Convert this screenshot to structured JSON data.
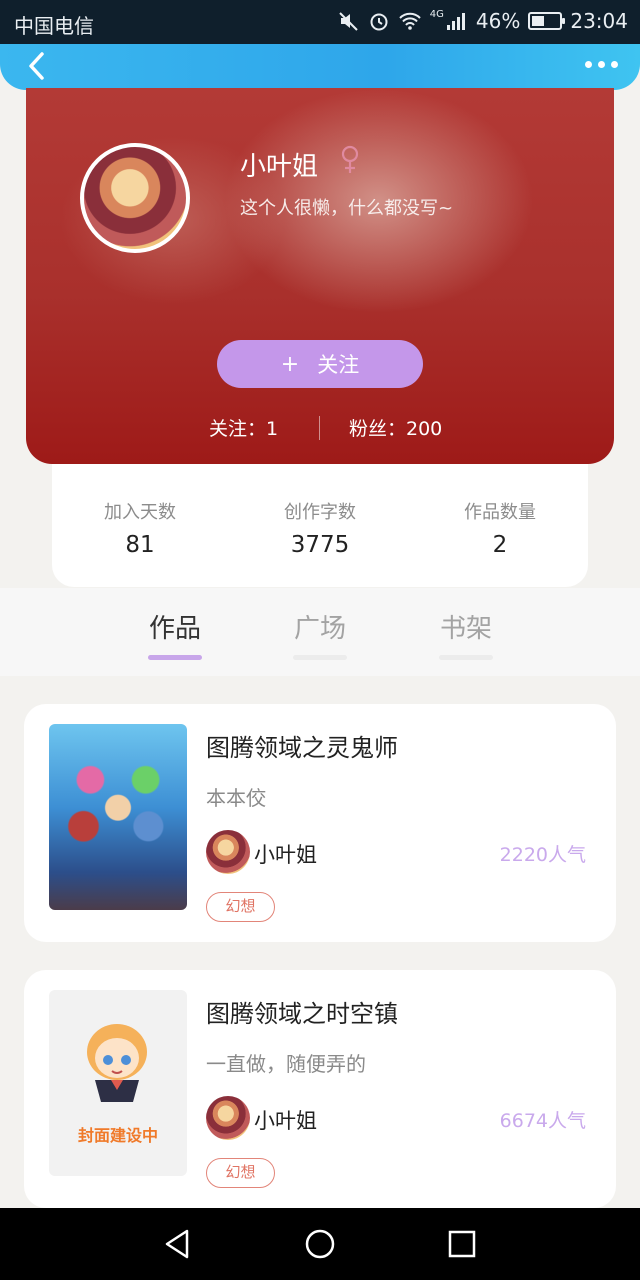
{
  "status_bar": {
    "carrier": "中国电信",
    "network": "4G",
    "battery_percent": "46%",
    "battery_level": 0.46,
    "time": "23:04",
    "icons": [
      "mute-icon",
      "alarm-icon",
      "wifi-icon",
      "signal-icon",
      "battery-icon"
    ]
  },
  "nav": {
    "back_icon": "chevron-left-icon",
    "more_icon": "more-dots-icon"
  },
  "profile": {
    "username": "小叶姐",
    "gender": "female",
    "bio": "这个人很懒，什么都没写~",
    "follow_plus": "+",
    "follow_label": "关注",
    "following": "关注：1",
    "fans": "粉丝：200"
  },
  "stats": {
    "days_label": "加入天数",
    "days_value": "81",
    "words_label": "创作字数",
    "words_value": "3775",
    "works_label": "作品数量",
    "works_value": "2"
  },
  "tabs": [
    {
      "label": "作品",
      "active": true
    },
    {
      "label": "广场",
      "active": false
    },
    {
      "label": "书架",
      "active": false
    }
  ],
  "books": [
    {
      "title": "图腾领域之灵鬼师",
      "description": "本本佼",
      "author": "小叶姐",
      "popularity": "2220人气",
      "tag": "幻想"
    },
    {
      "title": "图腾领域之时空镇",
      "description": "一直做，随便弄的",
      "author": "小叶姐",
      "popularity": "6674人气",
      "tag": "幻想",
      "cover_text": "封面建设中"
    }
  ],
  "colors": {
    "nav_blue": "#2ea6ea",
    "follow_purple": "#c497ea",
    "popularity_purple": "#c9a9ec",
    "tag_red": "#e07464",
    "header_red": "#a9302c"
  }
}
